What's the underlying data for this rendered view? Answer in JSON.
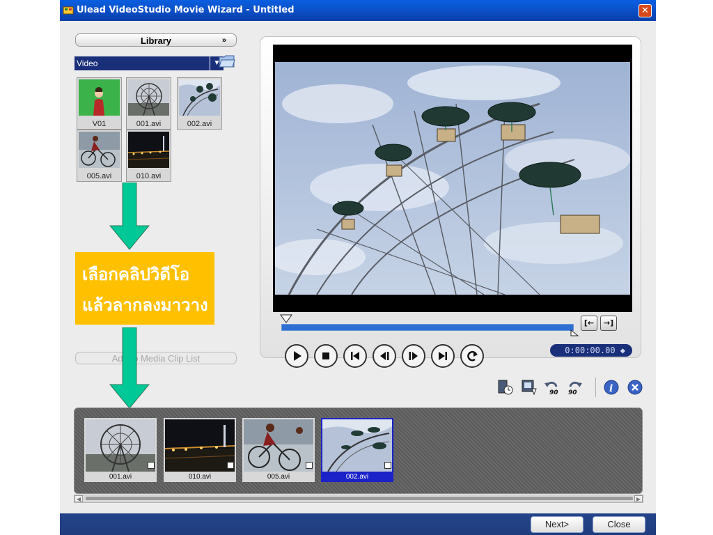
{
  "window": {
    "title": "Ulead VideoStudio Movie Wizard - Untitled"
  },
  "library": {
    "button_label": "Library",
    "type_value": "Video",
    "thumbnails": [
      {
        "label": "V01"
      },
      {
        "label": "001.avi"
      },
      {
        "label": "002.avi"
      },
      {
        "label": "005.avi"
      },
      {
        "label": "010.avi"
      }
    ],
    "add_button_label": "Add to Media Clip List"
  },
  "callout": {
    "line1": "เลือกคลิปวิดีโอ",
    "line2": "แล้วลากลงมาวาง",
    "color": "#ffc000",
    "arrow_color": "#00c896"
  },
  "player": {
    "timecode": "0:00:00.00",
    "mark_in_icon": "mark-in-icon",
    "mark_out_icon": "mark-out-icon",
    "transport": [
      "play-icon",
      "stop-icon",
      "home-icon",
      "previous-frame-icon",
      "next-frame-icon",
      "end-icon",
      "repeat-icon"
    ]
  },
  "toolbar_icons": [
    "clip-duration-icon",
    "save-frame-icon",
    "rotate-left-90-icon",
    "rotate-right-90-icon",
    "info-icon",
    "delete-icon"
  ],
  "timeline": {
    "clips": [
      {
        "label": "001.avi",
        "selected": false
      },
      {
        "label": "010.avi",
        "selected": false
      },
      {
        "label": "005.avi",
        "selected": false
      },
      {
        "label": "002.avi",
        "selected": true
      }
    ],
    "selected_color": "#1a22c8"
  },
  "buttons": {
    "next": "Next>",
    "close": "Close"
  }
}
